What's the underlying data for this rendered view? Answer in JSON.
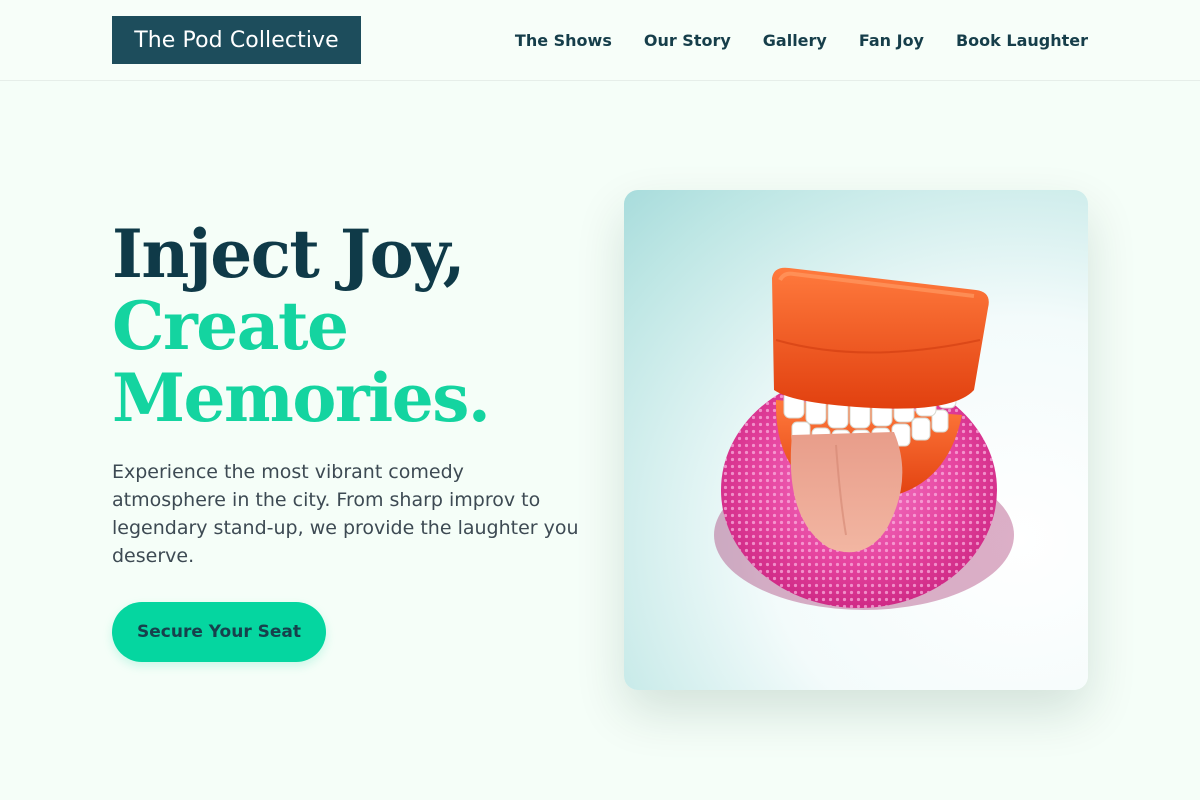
{
  "brand": {
    "name": "The Pod Collective"
  },
  "nav": {
    "items": [
      {
        "label": "The Shows"
      },
      {
        "label": "Our Story"
      },
      {
        "label": "Gallery"
      },
      {
        "label": "Fan Joy"
      },
      {
        "label": "Book Laughter"
      }
    ]
  },
  "hero": {
    "headline_line1": "Inject Joy,",
    "headline_line2": "Create",
    "headline_line3": "Memories.",
    "description": "Experience the most vibrant comedy atmosphere in the city. From sharp improv to legendary stand-up, we provide the laughter you deserve.",
    "cta_label": "Secure Your Seat",
    "image_label": "Wind-up chattering teeth toy with tongue out on a pink sponge"
  },
  "colors": {
    "background": "#f5fef8",
    "navy": "#0f3a48",
    "logo_bg": "#1d4d5c",
    "accent_green": "#14d4a0",
    "button": "#05d6a0",
    "body_text": "#3d4a53"
  }
}
